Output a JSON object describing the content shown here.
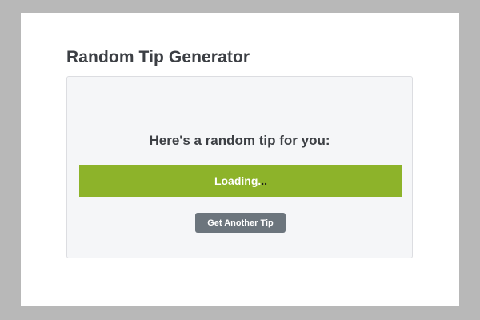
{
  "app": {
    "title": "Random Tip Generator"
  },
  "card": {
    "heading": "Here's a random tip for you:",
    "tip_text": "Loading.",
    "tip_trailing": "..",
    "button_label": "Get Another Tip"
  },
  "colors": {
    "tip_bar": "#8db32a",
    "button": "#6c757d",
    "background_frame": "#b8b8b8"
  }
}
